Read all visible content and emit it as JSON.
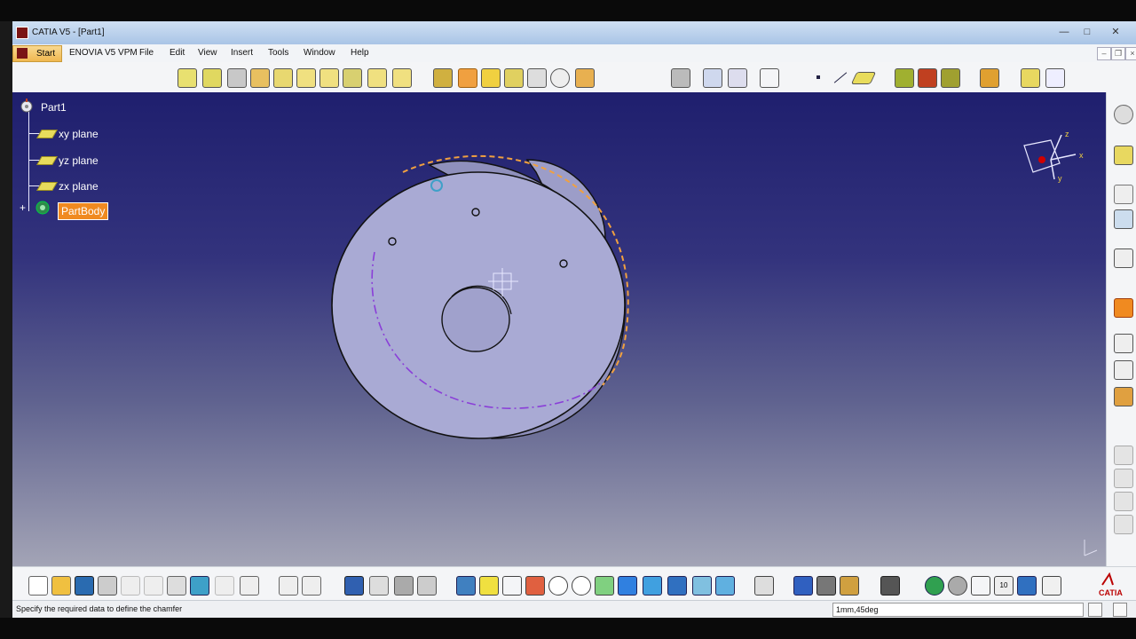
{
  "window": {
    "title": "CATIA V5 - [Part1]",
    "controls": [
      "—",
      "□",
      "✕"
    ]
  },
  "menu": {
    "start": "Start",
    "items": [
      "ENOVIA V5 VPM",
      "File",
      "Edit",
      "View",
      "Insert",
      "Tools",
      "Window",
      "Help"
    ]
  },
  "tree": {
    "root": "Part1",
    "planes": [
      "xy plane",
      "yz plane",
      "zx plane"
    ],
    "body": "PartBody"
  },
  "compass": {
    "x": "x",
    "y": "y",
    "z": "z"
  },
  "status": {
    "message": "Specify the required data to define the chamfer",
    "input_value": "1mm,45deg"
  },
  "brand": "CATIA",
  "colors": {
    "viewport_top": "#1f1f6e",
    "viewport_bottom": "#a3a4b6",
    "part_fill": "#a9aad4",
    "highlight_orange": "#f0a040",
    "highlight_purple": "#8a3ed8",
    "selected_body": "#f08a20"
  }
}
